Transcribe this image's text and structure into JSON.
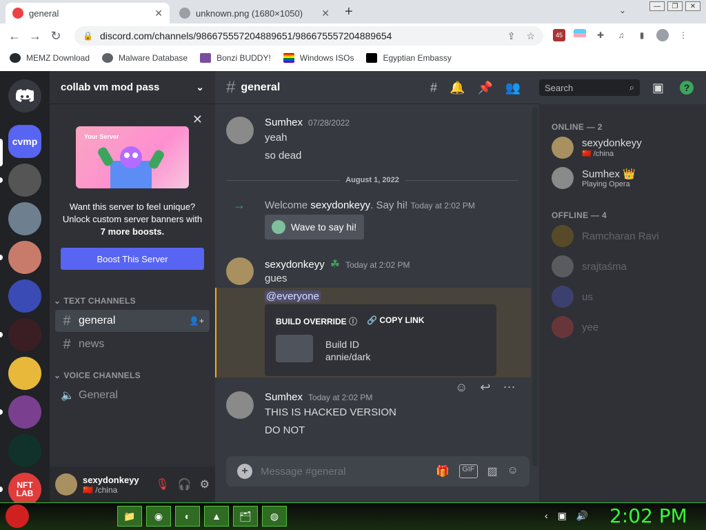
{
  "browser": {
    "tabs": [
      {
        "title": "general",
        "close": "✕"
      },
      {
        "title": "unknown.png (1680×1050)",
        "close": "✕"
      }
    ],
    "new_tab": "+",
    "tab_menu": "⌄",
    "window_controls": [
      "—",
      "❐",
      "✕"
    ],
    "nav": {
      "back": "←",
      "forward": "→",
      "reload": "↻"
    },
    "url": "discord.com/channels/986675557204889651/986675557204889654",
    "extension_badge": "45",
    "bookmarks": [
      {
        "label": "MEMZ Download",
        "icon": "github-icon",
        "color": "#24292e"
      },
      {
        "label": "Malware Database",
        "icon": "globe-icon",
        "color": "#5f6368"
      },
      {
        "label": "Bonzi BUDDY!",
        "icon": "bonzi-icon",
        "color": "#7a4e9e"
      },
      {
        "label": "Windows ISOs",
        "icon": "rainbow-flag-icon",
        "color": "#e40303"
      },
      {
        "label": "Egyptian Embassy",
        "icon": "wix-icon",
        "color": "#000000"
      }
    ]
  },
  "servers": [
    {
      "label": "",
      "color": "#36393f"
    },
    {
      "label": "cvmp",
      "color": "#5865f2"
    },
    {
      "label": "",
      "color": "#555555"
    },
    {
      "label": "",
      "color": "#6e7f8f"
    },
    {
      "label": "",
      "color": "#c97b6b"
    },
    {
      "label": "",
      "color": "#3a4bb5"
    },
    {
      "label": "",
      "color": "#3b1e24"
    },
    {
      "label": "",
      "color": "#e8b83a"
    },
    {
      "label": "",
      "color": "#7a3f8f"
    },
    {
      "label": "",
      "color": "#11312b"
    },
    {
      "label": "NFT LAB",
      "color": "#e03c3c"
    }
  ],
  "channels": {
    "server_name": "collab vm mod pass",
    "boost": {
      "close": "✕",
      "art_label": "Your Server",
      "text": "Want this server to feel unique? Unlock custom server banners with",
      "text_bold": "7 more boosts.",
      "button": "Boost This Server"
    },
    "text_category": "TEXT CHANNELS",
    "text_channels": [
      {
        "name": "general",
        "active": true
      },
      {
        "name": "news",
        "active": false
      }
    ],
    "voice_category": "VOICE CHANNELS",
    "voice_channels": [
      {
        "name": "General"
      }
    ]
  },
  "user_panel": {
    "name": "sexydonkeyy",
    "status": "/china",
    "flag": "🇨🇳"
  },
  "chat": {
    "channel": "general",
    "search_placeholder": "Search",
    "messages": [
      {
        "author": "Sumhex",
        "time": "07/28/2022",
        "lines": [
          "yeah",
          "so dead"
        ]
      }
    ],
    "date_divider": "August 1, 2022",
    "welcome": {
      "prefix": "Welcome",
      "user": "sexydonkeyy",
      "suffix": ". Say hi!",
      "time": "Today at 2:02 PM",
      "wave_button": "Wave to say hi!"
    },
    "message2": {
      "author": "sexydonkeyy",
      "time": "Today at 2:02 PM",
      "line": "gues",
      "mention": "@everyone"
    },
    "embed": {
      "title": "BUILD OVERRIDE",
      "copy_link": "COPY LINK",
      "field_label": "Build ID",
      "field_value": "annie/dark"
    },
    "message3": {
      "author": "Sumhex",
      "time": "Today at 2:02 PM",
      "lines": [
        "THIS IS HACKED VERSION",
        "DO NOT"
      ]
    },
    "composer_placeholder": "Message #general"
  },
  "members": {
    "online_title": "ONLINE — 2",
    "online": [
      {
        "name": "sexydonkeyy",
        "sub": "🇨🇳 /china",
        "avatar_color": "#a89060"
      },
      {
        "name": "Sumhex 👑",
        "sub": "Playing Opera",
        "avatar_color": "#8a8a8a"
      }
    ],
    "offline_title": "OFFLINE — 4",
    "offline": [
      {
        "name": "Ramcharan Ravi",
        "avatar_color": "#b8860b"
      },
      {
        "name": "srajtaśma",
        "avatar_color": "#bbbbbb"
      },
      {
        "name": "us",
        "avatar_color": "#5865f2"
      },
      {
        "name": "yee",
        "avatar_color": "#ed4245"
      }
    ]
  },
  "taskbar": {
    "clock": "2:02 PM",
    "apps": [
      "📁",
      "◉",
      "◐",
      "▲",
      "🗂",
      "◍"
    ]
  }
}
